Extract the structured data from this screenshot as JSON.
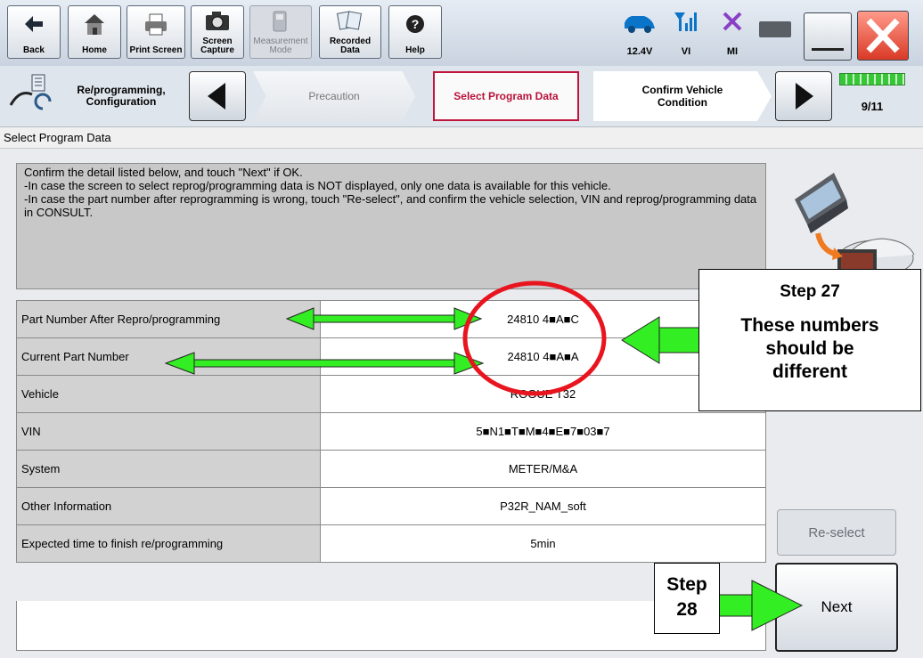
{
  "toolbar": {
    "back": "Back",
    "home": "Home",
    "print_screen": "Print Screen",
    "screen_capture": "Screen\nCapture",
    "measurement_mode": "Measurement\nMode",
    "recorded_data": "Recorded\nData",
    "help": "Help",
    "battery_voltage": "12.4V",
    "vi_label": "VI",
    "mi_label": "MI"
  },
  "breadcrumb": {
    "app_label": "Re/programming,\nConfiguration",
    "step_precaution": "Precaution",
    "step_select": "Select Program Data",
    "step_confirm": "Confirm Vehicle\nCondition",
    "page_counter": "9/11"
  },
  "section_title": "Select Program Data",
  "instructions": [
    "Confirm the detail listed below, and touch \"Next\" if OK.",
    "-In case the screen to select reprog/programming data is NOT displayed, only one data is available for this vehicle.",
    "-In case the part number after reprogramming is wrong, touch \"Re-select\", and confirm the vehicle selection, VIN and reprog/programming data in CONSULT."
  ],
  "rows": [
    {
      "label": "Part Number After Repro/programming",
      "value": "24810 4■A■C"
    },
    {
      "label": "Current Part Number",
      "value": "24810 4■A■A"
    },
    {
      "label": "Vehicle",
      "value": "ROGUE T32"
    },
    {
      "label": "VIN",
      "value": "5■N1■T■M■4■E■7■03■7"
    },
    {
      "label": "System",
      "value": "METER/M&A"
    },
    {
      "label": "Other Information",
      "value": "P32R_NAM_soft"
    },
    {
      "label": "Expected time to finish re/programming",
      "value": "5min"
    }
  ],
  "buttons": {
    "reselect": "Re-select",
    "next": "Next"
  },
  "callouts": {
    "step27_title": "Step 27",
    "step27_text": "These numbers should be different",
    "step28_line1": "Step",
    "step28_line2": "28"
  },
  "colors": {
    "active_step_border": "#c0143c",
    "annotation_red": "#e8141e",
    "annotation_green": "#33ee22",
    "close_red": "#e0452f"
  }
}
